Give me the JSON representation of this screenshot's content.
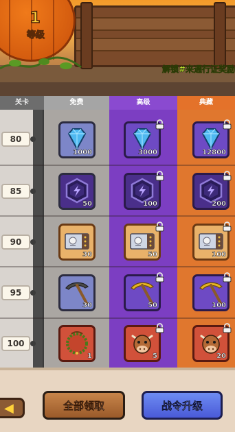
{
  "header": {
    "level_value": "1",
    "level_label": "等级",
    "unlock_text": "解锁#来通行证奖励"
  },
  "columns": {
    "level": "关卡",
    "free": "免费",
    "advanced": "高级",
    "premium": "典藏"
  },
  "rows": [
    {
      "level": "80",
      "free": {
        "icon": "diamond-icon",
        "qty": "1000"
      },
      "advanced": {
        "icon": "diamond-icon",
        "qty": "3000",
        "locked": true
      },
      "premium": {
        "icon": "diamond-icon",
        "qty": "12800",
        "locked": true
      }
    },
    {
      "level": "85",
      "free": {
        "icon": "energy-hexagon-icon",
        "qty": "50"
      },
      "advanced": {
        "icon": "energy-hexagon-icon",
        "qty": "100",
        "locked": true
      },
      "premium": {
        "icon": "energy-hexagon-icon",
        "qty": "200",
        "locked": true
      }
    },
    {
      "level": "90",
      "free": {
        "icon": "ticket-icon",
        "qty": "30"
      },
      "advanced": {
        "icon": "ticket-icon",
        "qty": "50",
        "locked": true
      },
      "premium": {
        "icon": "ticket-icon",
        "qty": "100",
        "locked": true
      }
    },
    {
      "level": "95",
      "free": {
        "icon": "iron-pickaxe-icon",
        "qty": "30"
      },
      "advanced": {
        "icon": "gold-pickaxe-icon",
        "qty": "50",
        "locked": true
      },
      "premium": {
        "icon": "gold-pickaxe-icon",
        "qty": "100",
        "locked": true
      }
    },
    {
      "level": "100",
      "free": {
        "icon": "wreath-frame-icon",
        "qty": "1"
      },
      "advanced": {
        "icon": "cow-icon",
        "qty": "5",
        "locked": true
      },
      "premium": {
        "icon": "cow-icon",
        "qty": "20",
        "locked": true
      }
    }
  ],
  "footer": {
    "back_icon": "back-arrow-icon",
    "claim_all_label": "全部领取",
    "upgrade_label": "战令升级"
  },
  "colors": {
    "free_column": "#aaa6a2",
    "advanced_column": "#7c3ec2",
    "premium_column": "#e0772e",
    "upgrade_button": "#5a6ae0",
    "claim_button": "#b06e3a"
  }
}
